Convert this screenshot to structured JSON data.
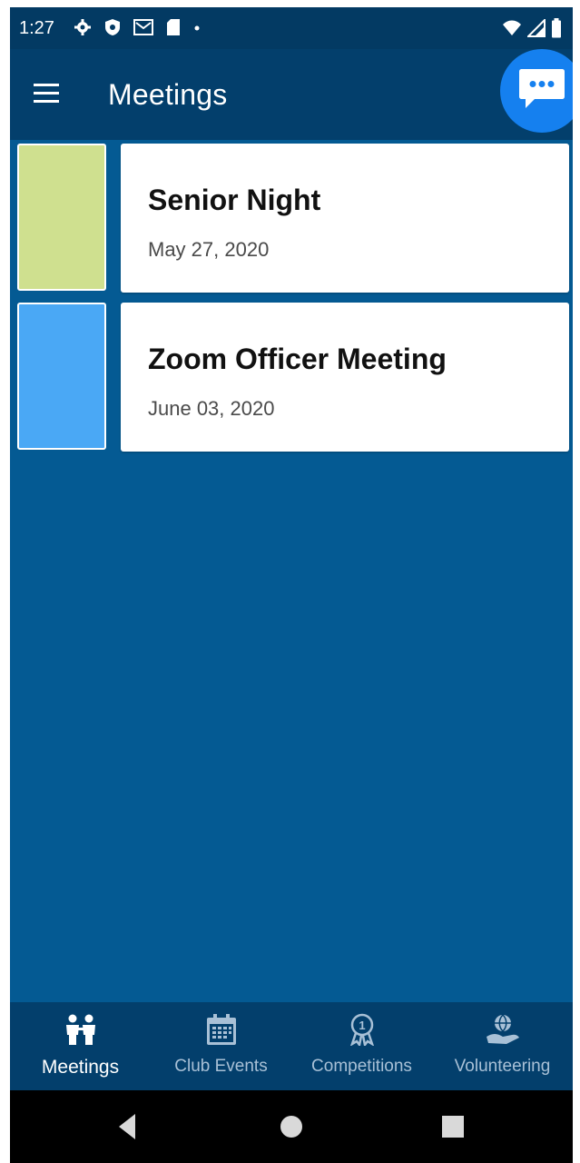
{
  "status_bar": {
    "time": "1:27",
    "left_icons": [
      "settings-icon",
      "shield-icon",
      "gmail-icon",
      "sd-card-icon",
      "dot-icon"
    ],
    "right_icons": [
      "wifi-icon",
      "signal-icon",
      "battery-icon"
    ]
  },
  "app_bar": {
    "title": "Meetings",
    "menu_icon": "hamburger-menu-icon",
    "chat_icon": "chat-bubble-icon",
    "chat_color": "#1580ef"
  },
  "meetings": [
    {
      "title": "Senior Night",
      "date": "May 27, 2020",
      "color": "#cfe08f"
    },
    {
      "title": "Zoom Officer Meeting",
      "date": "June 03, 2020",
      "color": "#4aa8f5"
    }
  ],
  "bottom_nav": {
    "items": [
      {
        "label": "Meetings",
        "icon": "people-icon",
        "active": true
      },
      {
        "label": "Club Events",
        "icon": "calendar-icon",
        "active": false
      },
      {
        "label": "Competitions",
        "icon": "award-ribbon-icon",
        "active": false
      },
      {
        "label": "Volunteering",
        "icon": "globe-hand-icon",
        "active": false
      }
    ]
  },
  "system_nav": {
    "buttons": [
      "back-icon",
      "home-icon",
      "recents-icon"
    ]
  },
  "colors": {
    "background": "#045a93",
    "status_bar": "#033a63",
    "app_bar": "#033f6c",
    "bottom_nav": "#033f6c",
    "active_tab_label": "#ffffff",
    "inactive_tab_label": "#a8c0d6"
  }
}
